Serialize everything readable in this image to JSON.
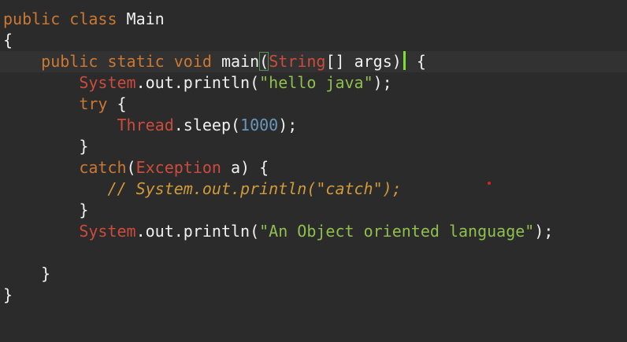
{
  "editor": {
    "lines": [
      {
        "indent": "",
        "tokens": [
          {
            "t": "public",
            "c": "kw"
          },
          {
            "t": " ",
            "c": "plain"
          },
          {
            "t": "class",
            "c": "kw"
          },
          {
            "t": " Main",
            "c": "plain"
          }
        ]
      },
      {
        "indent": "",
        "tokens": [
          {
            "t": "{",
            "c": "plain"
          }
        ]
      },
      {
        "indent": "    ",
        "tokens": [
          {
            "t": "public",
            "c": "kw"
          },
          {
            "t": " ",
            "c": "plain"
          },
          {
            "t": "static",
            "c": "kw"
          },
          {
            "t": " ",
            "c": "plain"
          },
          {
            "t": "void",
            "c": "kw"
          },
          {
            "t": " main",
            "c": "plain"
          },
          {
            "t": "(",
            "c": "plain",
            "match": true
          },
          {
            "t": "String",
            "c": "cls"
          },
          {
            "t": "[] args)",
            "c": "plain"
          },
          {
            "t": "",
            "c": "caret"
          },
          {
            "t": " {",
            "c": "plain"
          }
        ]
      },
      {
        "indent": "        ",
        "tokens": [
          {
            "t": "System",
            "c": "cls"
          },
          {
            "t": ".out.println(",
            "c": "plain"
          },
          {
            "t": "\"hello java\"",
            "c": "str"
          },
          {
            "t": ");",
            "c": "plain"
          }
        ]
      },
      {
        "indent": "        ",
        "tokens": [
          {
            "t": "try",
            "c": "kw"
          },
          {
            "t": " {",
            "c": "plain"
          }
        ]
      },
      {
        "indent": "            ",
        "tokens": [
          {
            "t": "Thread",
            "c": "cls"
          },
          {
            "t": ".sleep(",
            "c": "plain"
          },
          {
            "t": "1000",
            "c": "num"
          },
          {
            "t": ");",
            "c": "plain"
          }
        ]
      },
      {
        "indent": "        ",
        "tokens": [
          {
            "t": "}",
            "c": "plain"
          }
        ]
      },
      {
        "indent": "        ",
        "tokens": [
          {
            "t": "catch",
            "c": "kw"
          },
          {
            "t": "(",
            "c": "plain"
          },
          {
            "t": "Exception",
            "c": "cls"
          },
          {
            "t": " a) {",
            "c": "plain"
          }
        ]
      },
      {
        "indent": "           ",
        "tokens": [
          {
            "t": "// System.out.println(\"catch\");",
            "c": "cmt"
          }
        ]
      },
      {
        "indent": "        ",
        "tokens": [
          {
            "t": "}",
            "c": "plain"
          }
        ]
      },
      {
        "indent": "        ",
        "tokens": [
          {
            "t": "System",
            "c": "cls"
          },
          {
            "t": ".out.println(",
            "c": "plain"
          },
          {
            "t": "\"An Object oriented language\"",
            "c": "str"
          },
          {
            "t": ");",
            "c": "plain"
          }
        ]
      },
      {
        "indent": "",
        "tokens": []
      },
      {
        "indent": "    ",
        "tokens": [
          {
            "t": "}",
            "c": "plain"
          }
        ]
      },
      {
        "indent": "",
        "tokens": [
          {
            "t": "}",
            "c": "plain"
          }
        ]
      }
    ]
  },
  "colors": {
    "background": "#2b2b2b",
    "keyword": "#cc7832",
    "class_name": "#cc4b3d",
    "string": "#8fbf4f",
    "number": "#6897bb",
    "comment": "#d09a3a",
    "caret": "#7fe030"
  }
}
